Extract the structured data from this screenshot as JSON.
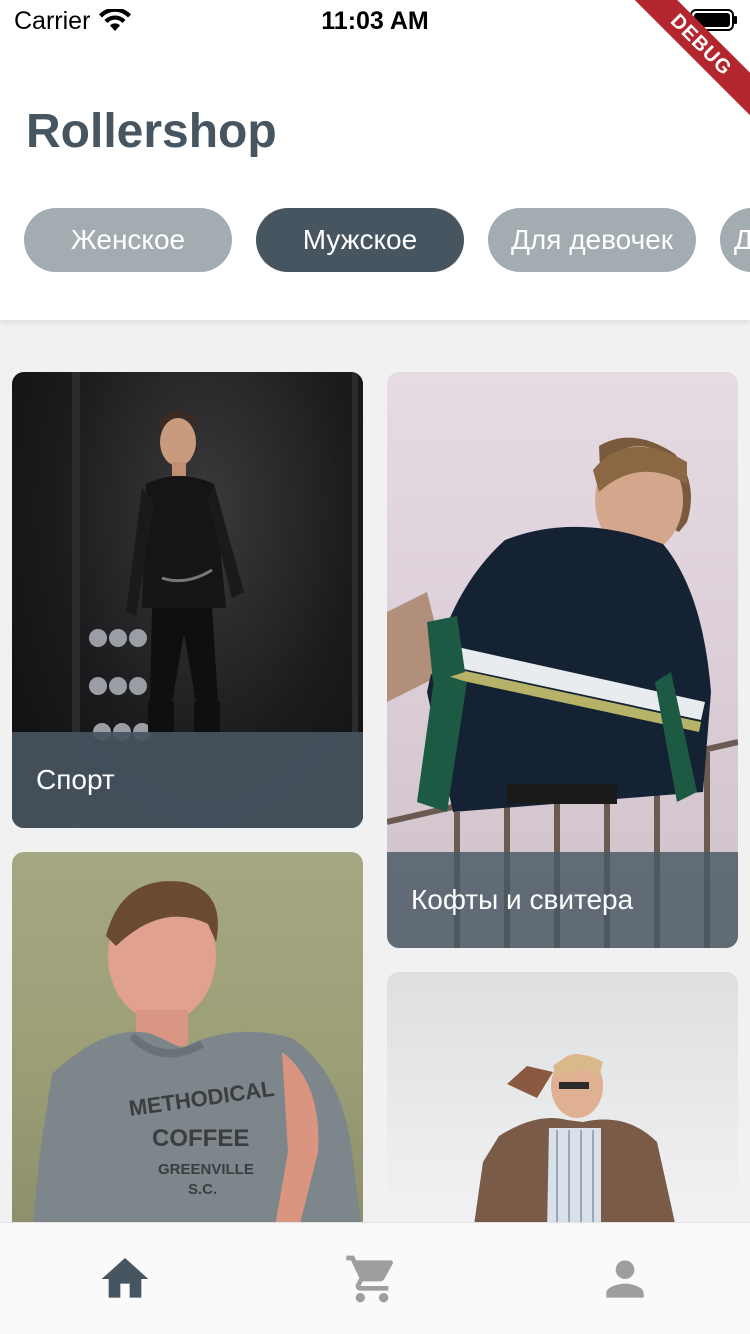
{
  "status_bar": {
    "carrier": "Carrier",
    "time": "11:03 AM",
    "wifi_icon": "wifi-icon",
    "battery_icon": "battery-icon"
  },
  "debug_banner": {
    "label": "DEBUG",
    "color": "#b3262d"
  },
  "header": {
    "title": "Rollershop",
    "title_color": "#46555f"
  },
  "categories": {
    "active_color": "#46555f",
    "inactive_color": "#a3acb0",
    "items": [
      {
        "label": "Женское",
        "active": false
      },
      {
        "label": "Мужское",
        "active": true
      },
      {
        "label": "Для девочек",
        "active": false
      },
      {
        "label": "Д",
        "active": false
      }
    ]
  },
  "cards": [
    {
      "label": "Спорт",
      "icon": "sport-photo"
    },
    {
      "label": "Кофты и свитера",
      "icon": "sweater-photo"
    },
    {
      "label": "",
      "icon": "tshirt-photo",
      "print_text": "METHODICAL COFFEE GREENVILLE S.C."
    },
    {
      "label": "",
      "icon": "jacket-photo"
    }
  ],
  "bottom_nav": {
    "items": [
      {
        "icon": "home-icon",
        "active": true,
        "color": "#46555f"
      },
      {
        "icon": "cart-icon",
        "active": false,
        "color": "#9e9e9e"
      },
      {
        "icon": "person-icon",
        "active": false,
        "color": "#9e9e9e"
      }
    ]
  }
}
